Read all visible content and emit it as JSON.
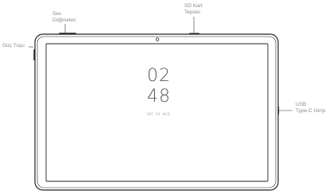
{
  "labels": {
    "volume_buttons": [
      "Ses",
      "Düğmeleri"
    ],
    "sd_card_tray": [
      "SD Kart",
      "Tepsisi"
    ],
    "power_button": "Güç Tuşu",
    "usb_port": [
      "USB",
      "Type-C Girişi"
    ]
  },
  "screen": {
    "clock_hour": "02",
    "clock_minute": "48",
    "date": "SAT. 18. AUG."
  },
  "colors": {
    "outline": "#222222",
    "label_text": "#8a8a8a",
    "leader_line": "#333333"
  }
}
